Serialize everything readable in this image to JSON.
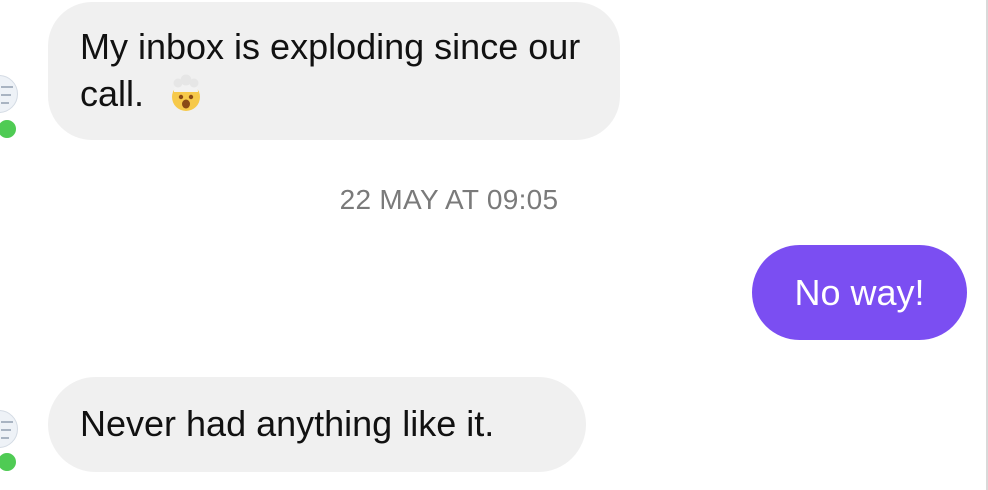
{
  "conversation": {
    "messages": [
      {
        "sender": "contact",
        "text": "My inbox is exploding since our call.",
        "emoji": "exploding-head-emoji"
      },
      {
        "sender": "me",
        "text": "No way!"
      },
      {
        "sender": "contact",
        "text": "Never had anything like it."
      }
    ],
    "timestamp": "22 MAY AT 09:05",
    "contact_online": true
  },
  "colors": {
    "incoming_bubble": "#f0f0f0",
    "outgoing_bubble": "#7b4ef2",
    "online_dot": "#4fcb54",
    "timestamp_text": "#7a7a7a"
  },
  "icons": {
    "avatar": "contact-avatar",
    "status": "online-status-icon",
    "emoji": "exploding-head-emoji"
  }
}
